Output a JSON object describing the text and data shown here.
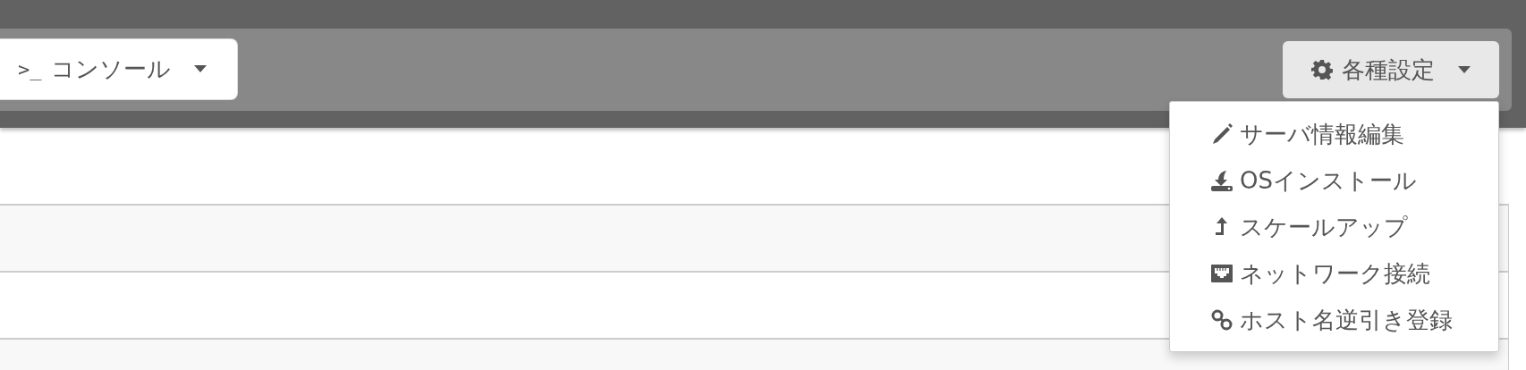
{
  "toolbar": {
    "console_button": {
      "icon_text": ">_",
      "label": "コンソール"
    },
    "settings_button": {
      "label": "各種設定",
      "expanded": true
    }
  },
  "settings_menu": [
    {
      "kind": "edit",
      "label": "サーバ情報編集"
    },
    {
      "kind": "install",
      "label": "OSインストール"
    },
    {
      "kind": "scaleup",
      "label": "スケールアップ"
    },
    {
      "kind": "network",
      "label": "ネットワーク接続"
    },
    {
      "kind": "link",
      "label": "ホスト名逆引き登録"
    }
  ]
}
